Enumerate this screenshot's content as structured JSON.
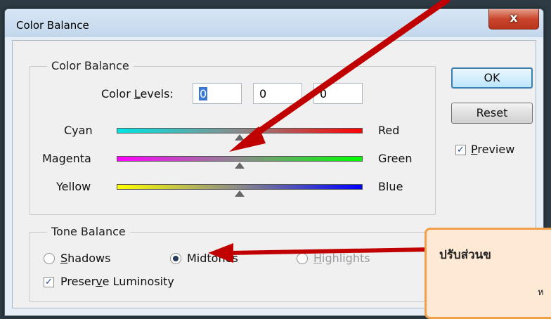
{
  "window": {
    "title": "Color Balance",
    "close_label": "x"
  },
  "color_balance": {
    "group_label": "Color Balance",
    "levels_label": "Color Levels:",
    "levels": [
      "0",
      "0",
      "0"
    ],
    "sliders": [
      {
        "left": "Cyan",
        "right": "Red",
        "value": 0
      },
      {
        "left": "Magenta",
        "right": "Green",
        "value": 0
      },
      {
        "left": "Yellow",
        "right": "Blue",
        "value": 0
      }
    ]
  },
  "tone_balance": {
    "group_label": "Tone Balance",
    "options": [
      "Shadows",
      "Midtones",
      "Highlights"
    ],
    "selected": "Midtones",
    "preserve_luminosity": "Preserve Luminosity",
    "preserve_checked": true
  },
  "buttons": {
    "ok": "OK",
    "reset": "Reset"
  },
  "preview": {
    "label": "Preview",
    "checked": true
  },
  "callout": {
    "text": "ปรับส่วนข",
    "sub": "ห"
  },
  "colors": {
    "arrow": "#c00000",
    "callout_border": "#f0a04a",
    "callout_fill": "#fde9d4"
  }
}
